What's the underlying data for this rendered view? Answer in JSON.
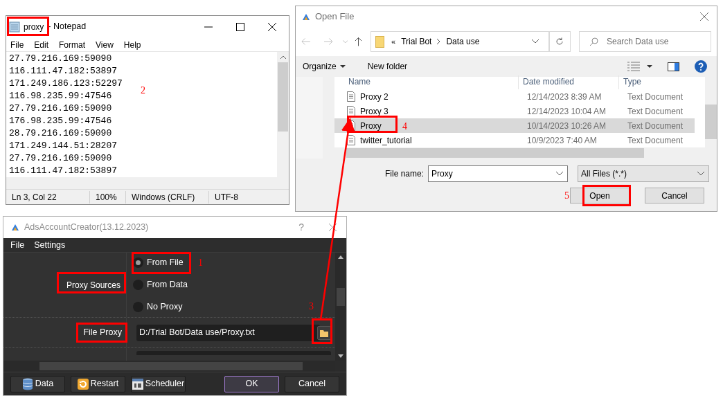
{
  "notepad": {
    "file_name": "proxy",
    "app_name": "- Notepad",
    "menu": [
      "File",
      "Edit",
      "Format",
      "View",
      "Help"
    ],
    "lines": [
      "27.79.216.169:59090",
      "116.111.47.182:53897",
      "171.249.186.123:52297",
      "116.98.235.99:47546",
      "27.79.216.169:59090",
      "176.98.235.99:47546",
      "28.79.216.169:59090",
      "171.249.144.51:28207",
      "27.79.216.169:59090",
      "116.111.47.182:53897"
    ],
    "status": [
      "Ln 3, Col 22",
      "100%",
      "Windows (CRLF)",
      "UTF-8"
    ]
  },
  "open_file": {
    "title": "Open File",
    "path_prefix": "«",
    "path": [
      "Trial Bot",
      "Data use"
    ],
    "search_placeholder": "Search Data use",
    "toolbar": [
      "Organize",
      "New folder"
    ],
    "columns": [
      "Name",
      "Date modified",
      "Type"
    ],
    "rows": [
      {
        "name": "Proxy 2",
        "date": "12/14/2023 8:39 AM",
        "type": "Text Document",
        "selected": false
      },
      {
        "name": "Proxy 3",
        "date": "12/14/2023 10:04 AM",
        "type": "Text Document",
        "selected": false
      },
      {
        "name": "Proxy",
        "date": "10/14/2023 10:26 AM",
        "type": "Text Document",
        "selected": true
      },
      {
        "name": "twitter_tutorial",
        "date": "10/9/2023 7:40 AM",
        "type": "Text Document",
        "selected": false
      }
    ],
    "file_name_label": "File name:",
    "file_name": "Proxy",
    "filter": "All Files (*.*)",
    "buttons": [
      "Open",
      "Cancel"
    ]
  },
  "ads": {
    "title": "AdsAccountCreator(13.12.2023)",
    "help": "?",
    "menu": [
      "File",
      "Settings"
    ],
    "proxy_sources_label": "Proxy Sources",
    "radios": [
      {
        "label": "From File",
        "selected": true
      },
      {
        "label": "From Data",
        "selected": false
      },
      {
        "label": "No Proxy",
        "selected": false
      }
    ],
    "file_proxy_label": "File Proxy",
    "file_proxy": "D:/Trial Bot/Data use/Proxy.txt",
    "buttons": [
      {
        "label": "Data",
        "kind": "data"
      },
      {
        "label": "Restart",
        "kind": "restart"
      },
      {
        "label": "Scheduler",
        "kind": "scheduler"
      },
      {
        "label": "OK",
        "kind": "ok"
      },
      {
        "label": "Cancel",
        "kind": "cancel"
      }
    ]
  },
  "annotations": [
    "1",
    "2",
    "3",
    "4",
    "5"
  ]
}
